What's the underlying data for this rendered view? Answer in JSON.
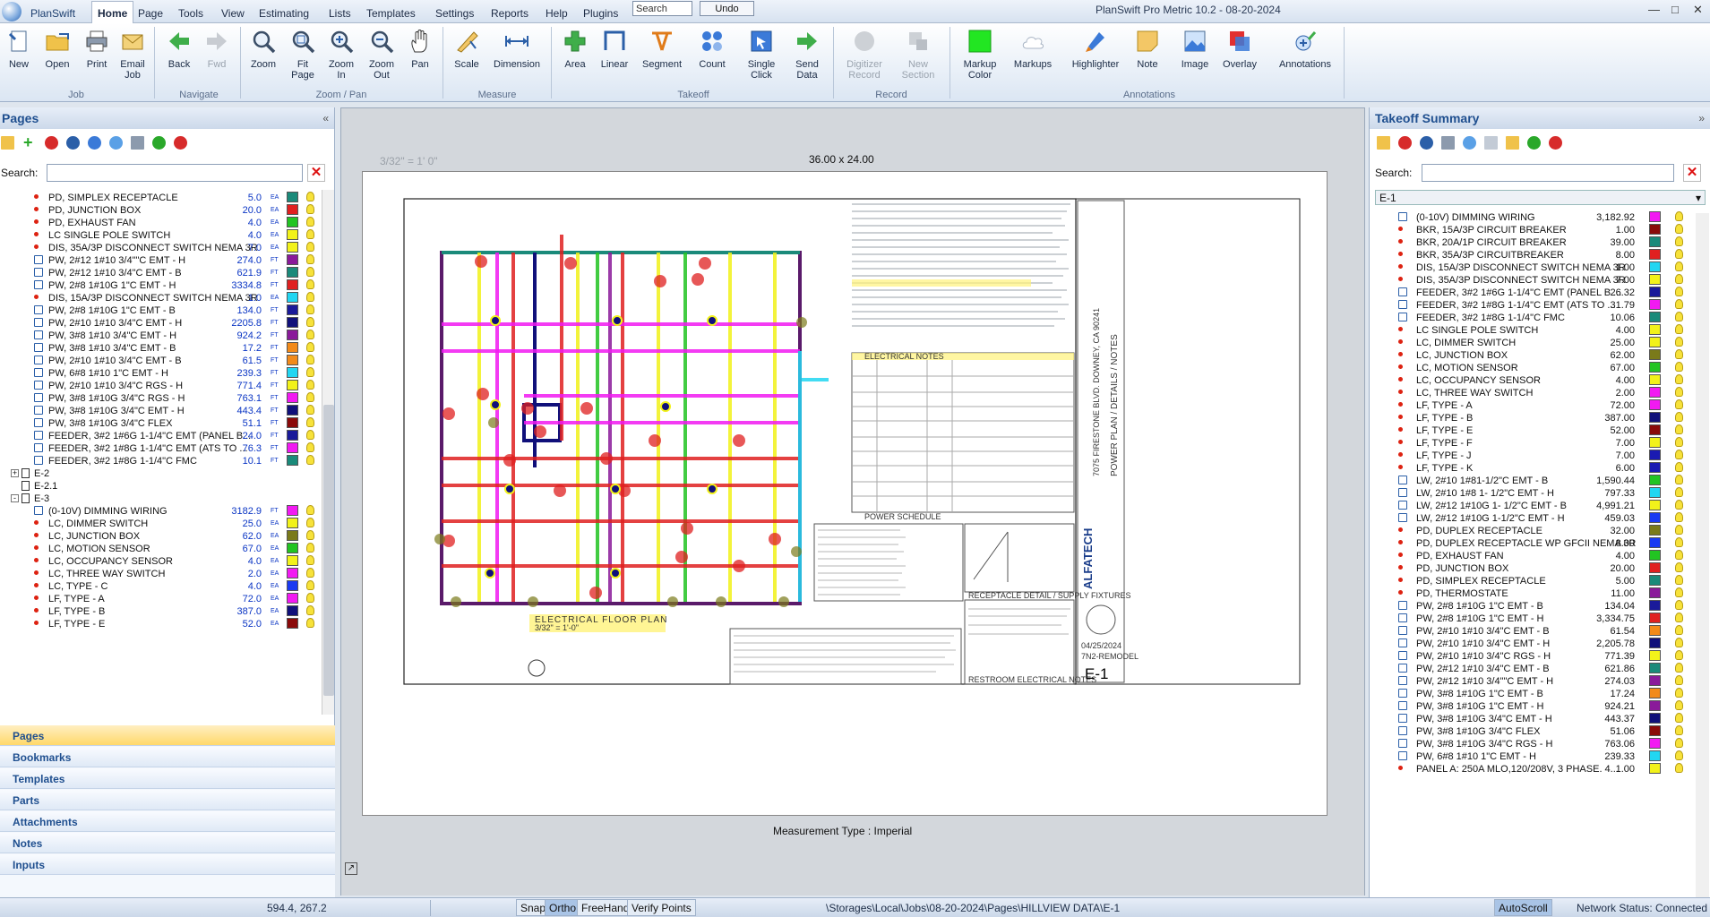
{
  "app": {
    "name": "PlanSwift",
    "window_title": "PlanSwift Pro Metric 10.2 - 08-20-2024"
  },
  "menu": {
    "items": [
      "Home",
      "Page",
      "Tools",
      "View",
      "Estimating",
      "Lists",
      "Templates",
      "Settings",
      "Reports",
      "Help",
      "Plugins"
    ],
    "active": "Home",
    "search_placeholder": "Search",
    "undo_label": "Undo"
  },
  "ribbon": {
    "buttons": [
      {
        "label": "New",
        "icon": "new-document-icon"
      },
      {
        "label": "Open",
        "icon": "open-folder-icon"
      },
      {
        "label": "Print",
        "icon": "printer-icon"
      },
      {
        "label": "Email",
        "label2": "Job",
        "icon": "email-icon"
      },
      {
        "label": "Back",
        "icon": "back-arrow-icon"
      },
      {
        "label": "Fwd",
        "icon": "forward-arrow-icon"
      },
      {
        "label": "Zoom",
        "icon": "zoom-icon"
      },
      {
        "label": "Fit",
        "label2": "Page",
        "icon": "fit-page-icon"
      },
      {
        "label": "Zoom",
        "label2": "In",
        "icon": "zoom-in-icon"
      },
      {
        "label": "Zoom",
        "label2": "Out",
        "icon": "zoom-out-icon"
      },
      {
        "label": "Pan",
        "icon": "hand-icon"
      },
      {
        "label": "Scale",
        "icon": "scale-icon"
      },
      {
        "label": "Dimension",
        "icon": "dimension-icon"
      },
      {
        "label": "Area",
        "icon": "area-icon"
      },
      {
        "label": "Linear",
        "icon": "linear-icon"
      },
      {
        "label": "Segment",
        "icon": "segment-icon"
      },
      {
        "label": "Count",
        "icon": "count-icon"
      },
      {
        "label": "Single",
        "label2": "Click",
        "icon": "single-click-icon"
      },
      {
        "label": "Send",
        "label2": "Data",
        "icon": "send-data-icon"
      },
      {
        "label": "Digitizer",
        "label2": "Record",
        "icon": "digitizer-icon"
      },
      {
        "label": "New",
        "label2": "Section",
        "icon": "new-section-icon"
      },
      {
        "label": "Markup",
        "label2": "Color",
        "icon": "markup-color-icon"
      },
      {
        "label": "Markups",
        "icon": "markups-cloud-icon"
      },
      {
        "label": "Highlighter",
        "icon": "highlighter-icon"
      },
      {
        "label": "Note",
        "icon": "note-icon"
      },
      {
        "label": "Image",
        "icon": "image-icon"
      },
      {
        "label": "Overlay",
        "icon": "overlay-icon"
      },
      {
        "label": "Annotations",
        "icon": "annotations-icon"
      }
    ],
    "groups": [
      "Job",
      "Navigate",
      "Zoom / Pan",
      "Measure",
      "Takeoff",
      "Record",
      "Annotations"
    ]
  },
  "pages_panel": {
    "title": "Pages",
    "search_label": "Search:",
    "rows": [
      {
        "kind": "count",
        "name": "PD, SIMPLEX RECEPTACLE",
        "value": "5.0",
        "unit": "EA",
        "color": "#1a8a7a"
      },
      {
        "kind": "count",
        "name": "PD, JUNCTION BOX",
        "value": "20.0",
        "unit": "EA",
        "color": "#e02020"
      },
      {
        "kind": "count",
        "name": "PD, EXHAUST FAN",
        "value": "4.0",
        "unit": "EA",
        "color": "#22c422"
      },
      {
        "kind": "count",
        "name": "LC SINGLE POLE SWITCH",
        "value": "4.0",
        "unit": "EA",
        "color": "#f2f21a"
      },
      {
        "kind": "count",
        "name": "DIS, 35A/3P DISCONNECT SWITCH NEMA 3R",
        "value": "7.0",
        "unit": "EA",
        "color": "#f2f21a"
      },
      {
        "kind": "linear",
        "name": "PW, 2#12 1#10 3/4\"\"C EMT - H",
        "value": "274.0",
        "unit": "FT",
        "color": "#8a1a9a"
      },
      {
        "kind": "linear",
        "name": "PW, 2#12 1#10 3/4\"C EMT - B",
        "value": "621.9",
        "unit": "FT",
        "color": "#1a8a7a"
      },
      {
        "kind": "linear",
        "name": "PW, 2#8 1#10G 1\"C EMT - H",
        "value": "3334.8",
        "unit": "FT",
        "color": "#e02020"
      },
      {
        "kind": "count",
        "name": "DIS, 15A/3P DISCONNECT SWITCH NEMA 3R",
        "value": "1.0",
        "unit": "EA",
        "color": "#22d6f2"
      },
      {
        "kind": "linear",
        "name": "PW, 2#8 1#10G 1\"C EMT - B",
        "value": "134.0",
        "unit": "FT",
        "color": "#1a1a9a"
      },
      {
        "kind": "linear",
        "name": "PW, 2#10 1#10 3/4\"C EMT - H",
        "value": "2205.8",
        "unit": "FT",
        "color": "#10107a"
      },
      {
        "kind": "linear",
        "name": "PW, 3#8 1#10 3/4\"C EMT - H",
        "value": "924.2",
        "unit": "FT",
        "color": "#8a1a9a"
      },
      {
        "kind": "linear",
        "name": "PW, 3#8 1#10 3/4\"C EMT - B",
        "value": "17.2",
        "unit": "FT",
        "color": "#f28a1a"
      },
      {
        "kind": "linear",
        "name": "PW, 2#10 1#10 3/4\"C EMT - B",
        "value": "61.5",
        "unit": "FT",
        "color": "#f28a1a"
      },
      {
        "kind": "linear",
        "name": "PW, 6#8 1#10 1\"C EMT - H",
        "value": "239.3",
        "unit": "FT",
        "color": "#22d6f2"
      },
      {
        "kind": "linear",
        "name": "PW, 2#10 1#10 3/4\"C RGS - H",
        "value": "771.4",
        "unit": "FT",
        "color": "#f2f21a"
      },
      {
        "kind": "linear",
        "name": "PW, 3#8 1#10G 3/4\"C RGS - H",
        "value": "763.1",
        "unit": "FT",
        "color": "#f21af2"
      },
      {
        "kind": "linear",
        "name": "PW, 3#8 1#10G 3/4\"C EMT - H",
        "value": "443.4",
        "unit": "FT",
        "color": "#10107a"
      },
      {
        "kind": "linear",
        "name": "PW, 3#8 1#10G 3/4\"C FLEX",
        "value": "51.1",
        "unit": "FT",
        "color": "#8a0a0a"
      },
      {
        "kind": "linear",
        "name": "FEEDER, 3#2 1#6G 1-1/4\"C EMT (PANEL B...",
        "value": "24.0",
        "unit": "FT",
        "color": "#1a1a9a"
      },
      {
        "kind": "linear",
        "name": "FEEDER, 3#2 1#8G 1-1/4\"C EMT (ATS TO ...",
        "value": "76.3",
        "unit": "FT",
        "color": "#f21af2"
      },
      {
        "kind": "linear",
        "name": "FEEDER, 3#2 1#8G 1-1/4\"C FMC",
        "value": "10.1",
        "unit": "FT",
        "color": "#1a8a7a"
      },
      {
        "kind": "page",
        "name": "E-2",
        "expander": "+"
      },
      {
        "kind": "page",
        "name": "E-2.1",
        "expander": ""
      },
      {
        "kind": "page",
        "name": "E-3",
        "expander": "-"
      },
      {
        "kind": "linear",
        "name": "(0-10V) DIMMING WIRING",
        "value": "3182.9",
        "unit": "FT",
        "color": "#f21af2"
      },
      {
        "kind": "count",
        "name": "LC, DIMMER SWITCH",
        "value": "25.0",
        "unit": "EA",
        "color": "#f2f21a"
      },
      {
        "kind": "count",
        "name": "LC, JUNCTION BOX",
        "value": "62.0",
        "unit": "EA",
        "color": "#7a7a1a"
      },
      {
        "kind": "count",
        "name": "LC, MOTION SENSOR",
        "value": "67.0",
        "unit": "EA",
        "color": "#22c422"
      },
      {
        "kind": "count",
        "name": "LC, OCCUPANCY SENSOR",
        "value": "4.0",
        "unit": "EA",
        "color": "#f2f21a"
      },
      {
        "kind": "count",
        "name": "LC, THREE WAY SWITCH",
        "value": "2.0",
        "unit": "EA",
        "color": "#f21af2"
      },
      {
        "kind": "count",
        "name": "LC, TYPE - C",
        "value": "4.0",
        "unit": "EA",
        "color": "#1a3af2"
      },
      {
        "kind": "count",
        "name": "LF, TYPE - A",
        "value": "72.0",
        "unit": "EA",
        "color": "#f21af2"
      },
      {
        "kind": "count",
        "name": "LF, TYPE - B",
        "value": "387.0",
        "unit": "EA",
        "color": "#10107a"
      },
      {
        "kind": "count",
        "name": "LF, TYPE - E",
        "value": "52.0",
        "unit": "EA",
        "color": "#8a0a0a"
      }
    ]
  },
  "left_nav": {
    "tabs": [
      "Pages",
      "Bookmarks",
      "Templates",
      "Parts",
      "Attachments",
      "Notes",
      "Inputs"
    ],
    "active": "Pages"
  },
  "canvas": {
    "scale_note": "3/32\" = 1' 0\"",
    "sheet_size": "36.00 x 24.00",
    "measurement_type": "Measurement Type : Imperial"
  },
  "drawing": {
    "plan_title": "ELECTRICAL FLOOR PLAN",
    "plan_scale": "3/32\" = 1'-0\"",
    "schedule_title": "ELECTRICAL NOTES",
    "power_schedule": "POWER SCHEDULE",
    "receptacle_detail": "RECEPTACLE DETAIL / SUPPLY FIXTURES",
    "restroom_notes": "RESTROOM ELECTRICAL NOTES",
    "sheet_number": "E-1",
    "firm_name": "ALFATECH",
    "date": "04/25/2024",
    "project": "7N2-REMODEL",
    "sheet_caption": "POWER PLAN / DETAILS / NOTES",
    "address": "7075 FIRESTONE BLVD. DOWNEY, CA 90241"
  },
  "takeoff_panel": {
    "title": "Takeoff Summary",
    "search_label": "Search:",
    "sheet": "E-1",
    "rows": [
      {
        "kind": "linear",
        "name": "(0-10V) DIMMING WIRING",
        "value": "3,182.92",
        "color": "#f21af2"
      },
      {
        "kind": "count",
        "name": "BKR, 15A/3P CIRCUIT BREAKER",
        "value": "1.00",
        "color": "#8a0a0a"
      },
      {
        "kind": "count",
        "name": "BKR, 20A/1P CIRCUIT BREAKER",
        "value": "39.00",
        "color": "#1a8a7a"
      },
      {
        "kind": "count",
        "name": "BKR, 35A/3P CIRCUITBREAKER",
        "value": "8.00",
        "color": "#e02020"
      },
      {
        "kind": "count",
        "name": "DIS, 15A/3P DISCONNECT SWITCH NEMA 3R",
        "value": "1.00",
        "color": "#22d6f2"
      },
      {
        "kind": "count",
        "name": "DIS, 35A/3P DISCONNECT SWITCH NEMA 3R",
        "value": "7.00",
        "color": "#f2f21a"
      },
      {
        "kind": "linear",
        "name": "FEEDER, 3#2 1#6G 1-1/4\"C EMT (PANEL B ...",
        "value": "26.32",
        "color": "#1a1a9a"
      },
      {
        "kind": "linear",
        "name": "FEEDER, 3#2 1#8G 1-1/4\"C EMT (ATS TO ...",
        "value": "31.79",
        "color": "#f21af2"
      },
      {
        "kind": "linear",
        "name": "FEEDER, 3#2 1#8G 1-1/4\"C FMC",
        "value": "10.06",
        "color": "#1a8a7a"
      },
      {
        "kind": "count",
        "name": "LC SINGLE POLE SWITCH",
        "value": "4.00",
        "color": "#f2f21a"
      },
      {
        "kind": "count",
        "name": "LC, DIMMER SWITCH",
        "value": "25.00",
        "color": "#f2f21a"
      },
      {
        "kind": "count",
        "name": "LC, JUNCTION BOX",
        "value": "62.00",
        "color": "#7a7a1a"
      },
      {
        "kind": "count",
        "name": "LC, MOTION SENSOR",
        "value": "67.00",
        "color": "#22c422"
      },
      {
        "kind": "count",
        "name": "LC, OCCUPANCY SENSOR",
        "value": "4.00",
        "color": "#f2f21a"
      },
      {
        "kind": "count",
        "name": "LC, THREE WAY SWITCH",
        "value": "2.00",
        "color": "#f21af2"
      },
      {
        "kind": "count",
        "name": "LF, TYPE - A",
        "value": "72.00",
        "color": "#f21af2"
      },
      {
        "kind": "count",
        "name": "LF, TYPE - B",
        "value": "387.00",
        "color": "#10107a"
      },
      {
        "kind": "count",
        "name": "LF, TYPE - E",
        "value": "52.00",
        "color": "#8a0a0a"
      },
      {
        "kind": "count",
        "name": "LF, TYPE - F",
        "value": "7.00",
        "color": "#f2f21a"
      },
      {
        "kind": "count",
        "name": "LF, TYPE - J",
        "value": "7.00",
        "color": "#1a1ab2"
      },
      {
        "kind": "count",
        "name": "LF, TYPE - K",
        "value": "6.00",
        "color": "#1a1ab2"
      },
      {
        "kind": "linear",
        "name": "LW, 2#10 1#81-1/2\"C EMT - B",
        "value": "1,590.44",
        "color": "#22c422"
      },
      {
        "kind": "linear",
        "name": "LW, 2#10 1#8 1- 1/2\"C EMT - H",
        "value": "797.33",
        "color": "#22d6f2"
      },
      {
        "kind": "linear",
        "name": "LW, 2#12 1#10G 1- 1/2\"C EMT - B",
        "value": "4,991.21",
        "color": "#f2f21a"
      },
      {
        "kind": "linear",
        "name": "LW, 2#12 1#10G 1-1/2\"C EMT - H",
        "value": "459.03",
        "color": "#1a3af2"
      },
      {
        "kind": "count",
        "name": "PD, DUPLEX RECEPTACLE",
        "value": "32.00",
        "color": "#7a7a1a"
      },
      {
        "kind": "count",
        "name": "PD, DUPLEX RECEPTACLE WP GFCII NEMA 3R",
        "value": "8.00",
        "color": "#1a3af2"
      },
      {
        "kind": "count",
        "name": "PD, EXHAUST FAN",
        "value": "4.00",
        "color": "#22c422"
      },
      {
        "kind": "count",
        "name": "PD, JUNCTION BOX",
        "value": "20.00",
        "color": "#e02020"
      },
      {
        "kind": "count",
        "name": "PD, SIMPLEX RECEPTACLE",
        "value": "5.00",
        "color": "#1a8a7a"
      },
      {
        "kind": "count",
        "name": "PD, THERMOSTATE",
        "value": "11.00",
        "color": "#8a1a9a"
      },
      {
        "kind": "linear",
        "name": "PW, 2#8 1#10G 1\"C EMT - B",
        "value": "134.04",
        "color": "#1a1a9a"
      },
      {
        "kind": "linear",
        "name": "PW, 2#8 1#10G 1\"C EMT - H",
        "value": "3,334.75",
        "color": "#e02020"
      },
      {
        "kind": "linear",
        "name": "PW, 2#10 1#10 3/4\"C EMT - B",
        "value": "61.54",
        "color": "#f28a1a"
      },
      {
        "kind": "linear",
        "name": "PW, 2#10 1#10 3/4\"C EMT - H",
        "value": "2,205.78",
        "color": "#10107a"
      },
      {
        "kind": "linear",
        "name": "PW, 2#10 1#10 3/4\"C RGS - H",
        "value": "771.39",
        "color": "#f2f21a"
      },
      {
        "kind": "linear",
        "name": "PW, 2#12 1#10 3/4\"C EMT - B",
        "value": "621.86",
        "color": "#1a8a7a"
      },
      {
        "kind": "linear",
        "name": "PW, 2#12 1#10 3/4\"\"C EMT - H",
        "value": "274.03",
        "color": "#8a1a9a"
      },
      {
        "kind": "linear",
        "name": "PW, 3#8 1#10G 1\"C EMT - B",
        "value": "17.24",
        "color": "#f28a1a"
      },
      {
        "kind": "linear",
        "name": "PW, 3#8 1#10G 1\"C EMT - H",
        "value": "924.21",
        "color": "#8a1a9a"
      },
      {
        "kind": "linear",
        "name": "PW, 3#8 1#10G 3/4\"C EMT - H",
        "value": "443.37",
        "color": "#10107a"
      },
      {
        "kind": "linear",
        "name": "PW, 3#8 1#10G 3/4\"C FLEX",
        "value": "51.06",
        "color": "#8a0a0a"
      },
      {
        "kind": "linear",
        "name": "PW, 3#8 1#10G 3/4\"C RGS - H",
        "value": "763.06",
        "color": "#f21af2"
      },
      {
        "kind": "linear",
        "name": "PW, 6#8 1#10 1\"C EMT - H",
        "value": "239.33",
        "color": "#22d6f2"
      },
      {
        "kind": "count",
        "name": "PANEL A: 250A MLO,120/208V, 3 PHASE. 4...",
        "value": "1.00",
        "color": "#f2f21a"
      }
    ]
  },
  "statusbar": {
    "coords": "594.4, 267.2",
    "snap": "Snap",
    "ortho": "Ortho",
    "freehand": "FreeHand",
    "verify": "Verify Points",
    "path": "\\Storages\\Local\\Jobs\\08-20-2024\\Pages\\HILLVIEW DATA\\E-1",
    "autoscroll": "AutoScroll",
    "network": "Network Status: Connected"
  }
}
